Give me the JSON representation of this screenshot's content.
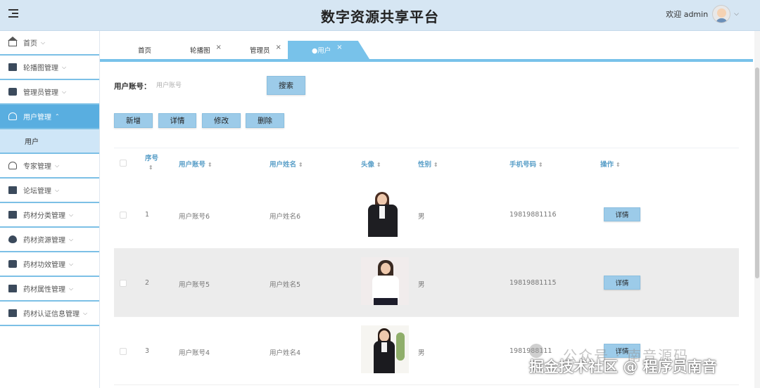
{
  "header": {
    "title": "数字资源共享平台",
    "welcome": "欢迎 admin"
  },
  "sidebar": {
    "items": [
      {
        "label": "首页",
        "icon": "home-icon"
      },
      {
        "label": "轮播图管理",
        "icon": "image-icon"
      },
      {
        "label": "管理员管理",
        "icon": "briefcase-icon"
      },
      {
        "label": "用户管理",
        "icon": "user-icon",
        "active": true,
        "children": [
          {
            "label": "用户"
          }
        ]
      },
      {
        "label": "专家管理",
        "icon": "user-icon"
      },
      {
        "label": "论坛管理",
        "icon": "forum-icon"
      },
      {
        "label": "药材分类管理",
        "icon": "book-icon"
      },
      {
        "label": "药材资源管理",
        "icon": "drop-icon"
      },
      {
        "label": "药材功效管理",
        "icon": "archive-icon"
      },
      {
        "label": "药材属性管理",
        "icon": "folder-icon"
      },
      {
        "label": "药材认证信息管理",
        "icon": "card-icon"
      }
    ],
    "active_color": "#59aee0"
  },
  "tabs": [
    {
      "label": "首页",
      "closable": false
    },
    {
      "label": "轮播图",
      "closable": true
    },
    {
      "label": "管理员",
      "closable": true
    },
    {
      "label": "●用户",
      "closable": true,
      "active": true
    }
  ],
  "tab_close_glyph": "×",
  "search": {
    "label": "用户账号：",
    "placeholder": "用户账号",
    "button": "搜索"
  },
  "actions": {
    "add": "新增",
    "detail": "详情",
    "edit": "修改",
    "delete": "删除"
  },
  "table": {
    "columns": [
      "序号",
      "用户账号",
      "用户姓名",
      "头像",
      "性别",
      "手机号码",
      "操作"
    ],
    "rows": [
      {
        "index": "1",
        "account": "用户账号6",
        "name": "用户姓名6",
        "gender": "男",
        "phone": "19819881116",
        "action": "详情"
      },
      {
        "index": "2",
        "account": "用户账号5",
        "name": "用户姓名5",
        "gender": "男",
        "phone": "19819881115",
        "action": "详情"
      },
      {
        "index": "3",
        "account": "用户账号4",
        "name": "用户姓名4",
        "gender": "男",
        "phone": "1981988111",
        "action": "详情"
      }
    ]
  },
  "watermarks": {
    "gray": "公众号 · 南音源码",
    "white": "掘金技术社区 @ 程序员南音"
  },
  "colors": {
    "header_bg": "#d6e6f3",
    "accent": "#78c2ea",
    "button_bg": "#9ccbe9",
    "header_text": "#5a9fc8"
  }
}
